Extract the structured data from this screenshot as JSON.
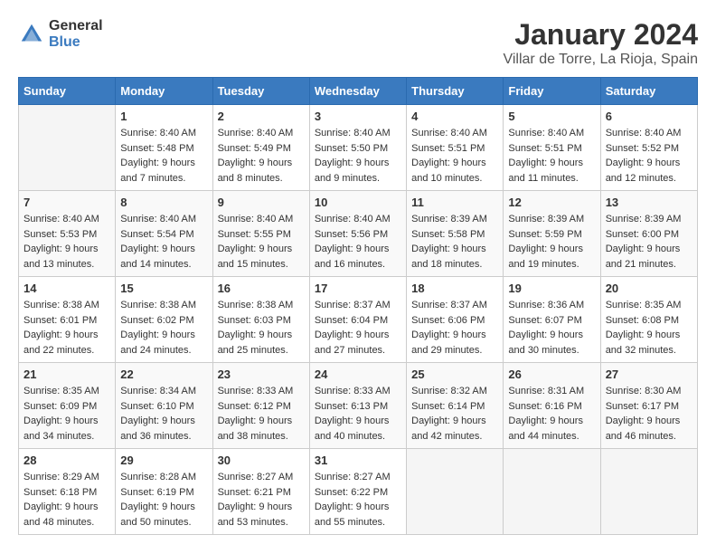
{
  "header": {
    "logo_line1": "General",
    "logo_line2": "Blue",
    "month": "January 2024",
    "location": "Villar de Torre, La Rioja, Spain"
  },
  "days_of_week": [
    "Sunday",
    "Monday",
    "Tuesday",
    "Wednesday",
    "Thursday",
    "Friday",
    "Saturday"
  ],
  "weeks": [
    [
      {
        "day": "",
        "sunrise": "",
        "sunset": "",
        "daylight": ""
      },
      {
        "day": "1",
        "sunrise": "Sunrise: 8:40 AM",
        "sunset": "Sunset: 5:48 PM",
        "daylight": "Daylight: 9 hours and 7 minutes."
      },
      {
        "day": "2",
        "sunrise": "Sunrise: 8:40 AM",
        "sunset": "Sunset: 5:49 PM",
        "daylight": "Daylight: 9 hours and 8 minutes."
      },
      {
        "day": "3",
        "sunrise": "Sunrise: 8:40 AM",
        "sunset": "Sunset: 5:50 PM",
        "daylight": "Daylight: 9 hours and 9 minutes."
      },
      {
        "day": "4",
        "sunrise": "Sunrise: 8:40 AM",
        "sunset": "Sunset: 5:51 PM",
        "daylight": "Daylight: 9 hours and 10 minutes."
      },
      {
        "day": "5",
        "sunrise": "Sunrise: 8:40 AM",
        "sunset": "Sunset: 5:51 PM",
        "daylight": "Daylight: 9 hours and 11 minutes."
      },
      {
        "day": "6",
        "sunrise": "Sunrise: 8:40 AM",
        "sunset": "Sunset: 5:52 PM",
        "daylight": "Daylight: 9 hours and 12 minutes."
      }
    ],
    [
      {
        "day": "7",
        "sunrise": "Sunrise: 8:40 AM",
        "sunset": "Sunset: 5:53 PM",
        "daylight": "Daylight: 9 hours and 13 minutes."
      },
      {
        "day": "8",
        "sunrise": "Sunrise: 8:40 AM",
        "sunset": "Sunset: 5:54 PM",
        "daylight": "Daylight: 9 hours and 14 minutes."
      },
      {
        "day": "9",
        "sunrise": "Sunrise: 8:40 AM",
        "sunset": "Sunset: 5:55 PM",
        "daylight": "Daylight: 9 hours and 15 minutes."
      },
      {
        "day": "10",
        "sunrise": "Sunrise: 8:40 AM",
        "sunset": "Sunset: 5:56 PM",
        "daylight": "Daylight: 9 hours and 16 minutes."
      },
      {
        "day": "11",
        "sunrise": "Sunrise: 8:39 AM",
        "sunset": "Sunset: 5:58 PM",
        "daylight": "Daylight: 9 hours and 18 minutes."
      },
      {
        "day": "12",
        "sunrise": "Sunrise: 8:39 AM",
        "sunset": "Sunset: 5:59 PM",
        "daylight": "Daylight: 9 hours and 19 minutes."
      },
      {
        "day": "13",
        "sunrise": "Sunrise: 8:39 AM",
        "sunset": "Sunset: 6:00 PM",
        "daylight": "Daylight: 9 hours and 21 minutes."
      }
    ],
    [
      {
        "day": "14",
        "sunrise": "Sunrise: 8:38 AM",
        "sunset": "Sunset: 6:01 PM",
        "daylight": "Daylight: 9 hours and 22 minutes."
      },
      {
        "day": "15",
        "sunrise": "Sunrise: 8:38 AM",
        "sunset": "Sunset: 6:02 PM",
        "daylight": "Daylight: 9 hours and 24 minutes."
      },
      {
        "day": "16",
        "sunrise": "Sunrise: 8:38 AM",
        "sunset": "Sunset: 6:03 PM",
        "daylight": "Daylight: 9 hours and 25 minutes."
      },
      {
        "day": "17",
        "sunrise": "Sunrise: 8:37 AM",
        "sunset": "Sunset: 6:04 PM",
        "daylight": "Daylight: 9 hours and 27 minutes."
      },
      {
        "day": "18",
        "sunrise": "Sunrise: 8:37 AM",
        "sunset": "Sunset: 6:06 PM",
        "daylight": "Daylight: 9 hours and 29 minutes."
      },
      {
        "day": "19",
        "sunrise": "Sunrise: 8:36 AM",
        "sunset": "Sunset: 6:07 PM",
        "daylight": "Daylight: 9 hours and 30 minutes."
      },
      {
        "day": "20",
        "sunrise": "Sunrise: 8:35 AM",
        "sunset": "Sunset: 6:08 PM",
        "daylight": "Daylight: 9 hours and 32 minutes."
      }
    ],
    [
      {
        "day": "21",
        "sunrise": "Sunrise: 8:35 AM",
        "sunset": "Sunset: 6:09 PM",
        "daylight": "Daylight: 9 hours and 34 minutes."
      },
      {
        "day": "22",
        "sunrise": "Sunrise: 8:34 AM",
        "sunset": "Sunset: 6:10 PM",
        "daylight": "Daylight: 9 hours and 36 minutes."
      },
      {
        "day": "23",
        "sunrise": "Sunrise: 8:33 AM",
        "sunset": "Sunset: 6:12 PM",
        "daylight": "Daylight: 9 hours and 38 minutes."
      },
      {
        "day": "24",
        "sunrise": "Sunrise: 8:33 AM",
        "sunset": "Sunset: 6:13 PM",
        "daylight": "Daylight: 9 hours and 40 minutes."
      },
      {
        "day": "25",
        "sunrise": "Sunrise: 8:32 AM",
        "sunset": "Sunset: 6:14 PM",
        "daylight": "Daylight: 9 hours and 42 minutes."
      },
      {
        "day": "26",
        "sunrise": "Sunrise: 8:31 AM",
        "sunset": "Sunset: 6:16 PM",
        "daylight": "Daylight: 9 hours and 44 minutes."
      },
      {
        "day": "27",
        "sunrise": "Sunrise: 8:30 AM",
        "sunset": "Sunset: 6:17 PM",
        "daylight": "Daylight: 9 hours and 46 minutes."
      }
    ],
    [
      {
        "day": "28",
        "sunrise": "Sunrise: 8:29 AM",
        "sunset": "Sunset: 6:18 PM",
        "daylight": "Daylight: 9 hours and 48 minutes."
      },
      {
        "day": "29",
        "sunrise": "Sunrise: 8:28 AM",
        "sunset": "Sunset: 6:19 PM",
        "daylight": "Daylight: 9 hours and 50 minutes."
      },
      {
        "day": "30",
        "sunrise": "Sunrise: 8:27 AM",
        "sunset": "Sunset: 6:21 PM",
        "daylight": "Daylight: 9 hours and 53 minutes."
      },
      {
        "day": "31",
        "sunrise": "Sunrise: 8:27 AM",
        "sunset": "Sunset: 6:22 PM",
        "daylight": "Daylight: 9 hours and 55 minutes."
      },
      {
        "day": "",
        "sunrise": "",
        "sunset": "",
        "daylight": ""
      },
      {
        "day": "",
        "sunrise": "",
        "sunset": "",
        "daylight": ""
      },
      {
        "day": "",
        "sunrise": "",
        "sunset": "",
        "daylight": ""
      }
    ]
  ]
}
